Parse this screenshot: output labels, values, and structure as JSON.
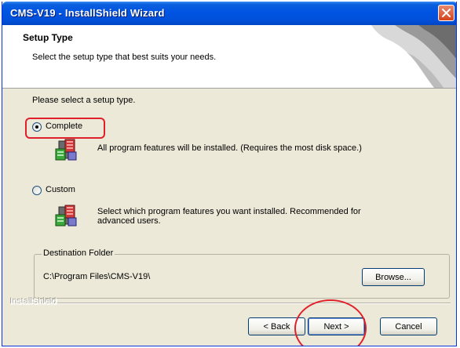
{
  "window": {
    "title": "CMS-V19 - InstallShield Wizard"
  },
  "header": {
    "title": "Setup Type",
    "subtitle": "Select the setup type that best suits your needs."
  },
  "prompt": "Please select a setup type.",
  "options": [
    {
      "label": "Complete",
      "description": "All program features will be installed. (Requires the most disk space.)",
      "selected": true
    },
    {
      "label": "Custom",
      "description_line1": "Select which program features you want installed. Recommended for",
      "description_line2": "advanced users.",
      "selected": false
    }
  ],
  "destination": {
    "legend": "Destination Folder",
    "path": "C:\\Program Files\\CMS-V19\\",
    "browse_label": "Browse..."
  },
  "brand": "InstallShield",
  "buttons": {
    "back": "< Back",
    "next": "Next >",
    "cancel": "Cancel"
  },
  "colors": {
    "titlebar": "#0054e3",
    "dialog_bg": "#ece9d8",
    "highlight": "#e0202a",
    "close_button": "#d5431d"
  },
  "icons": {
    "close": "close-icon",
    "package": "package-icon"
  }
}
